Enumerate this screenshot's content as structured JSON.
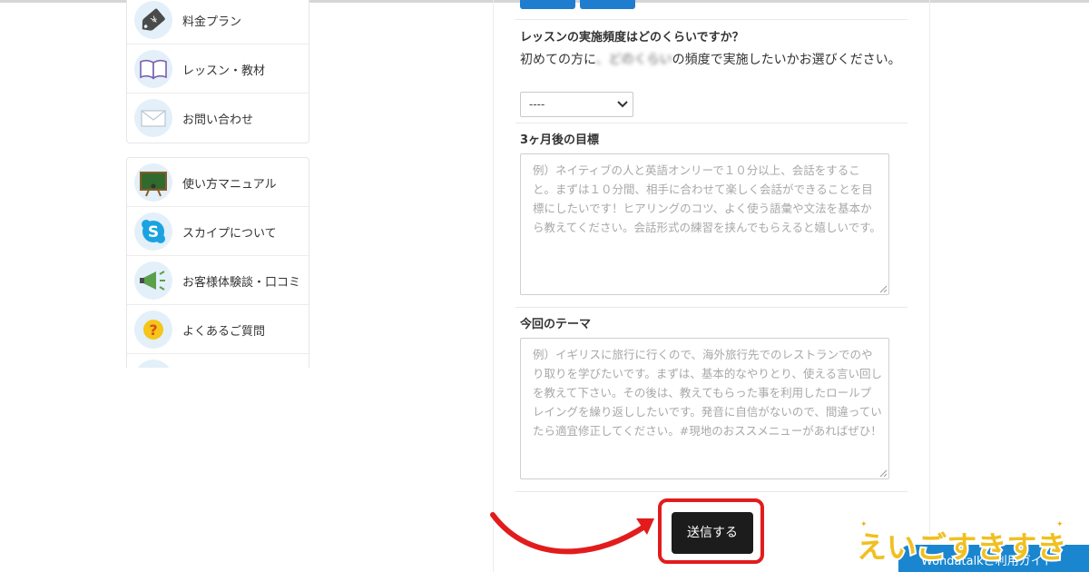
{
  "sidebar": {
    "group1": [
      {
        "label": "料金プラン",
        "icon": "price-tag-icon"
      },
      {
        "label": "レッスン・教材",
        "icon": "book-icon"
      },
      {
        "label": "お問い合わせ",
        "icon": "envelope-icon"
      }
    ],
    "group2": [
      {
        "label": "使い方マニュアル",
        "icon": "blackboard-icon"
      },
      {
        "label": "スカイプについて",
        "icon": "skype-icon"
      },
      {
        "label": "お客様体験談・口コミ",
        "icon": "megaphone-icon"
      },
      {
        "label": "よくあるご質問",
        "icon": "question-icon"
      }
    ]
  },
  "form": {
    "frequency": {
      "label": "レッスンの実施頻度はどのくらいですか？",
      "help_start": "初めての方に",
      "help_obscured": "、どのくらい",
      "help_end": "の頻度で実施したいかお選びください。",
      "select_value": "----"
    },
    "goal": {
      "label": "3ヶ月後の目標",
      "placeholder": "例）ネイティブの人と英語オンリーで１０分以上、会話をすること。まずは１０分間、相手に合わせて楽しく会話ができることを目標にしたいです！ヒアリングのコツ、よく使う語彙や文法を基本から教えてください。会話形式の練習を挟んでもらえると嬉しいです。"
    },
    "theme": {
      "label": "今回のテーマ",
      "placeholder": "例）イギリスに旅行に行くので、海外旅行先でのレストランでのやり取りを学びたいです。まずは、基本的なやりとり、使える言い回しを教えて下さい。その後は、教えてもらった事を利用したロールプレイングを繰り返ししたいです。発音に自信がないので、間違っていたら適宜修正してください。#現地のおススメニューがあればぜひ！"
    },
    "submit_label": "送信する"
  },
  "banner": {
    "text": "Wondatalkご利用ガイド",
    "logo_text": "えいごすきすき"
  },
  "colors": {
    "accent_blue": "#1a86cf",
    "highlight_red": "#e21c1c",
    "submit_bg": "#1c1c1c"
  }
}
